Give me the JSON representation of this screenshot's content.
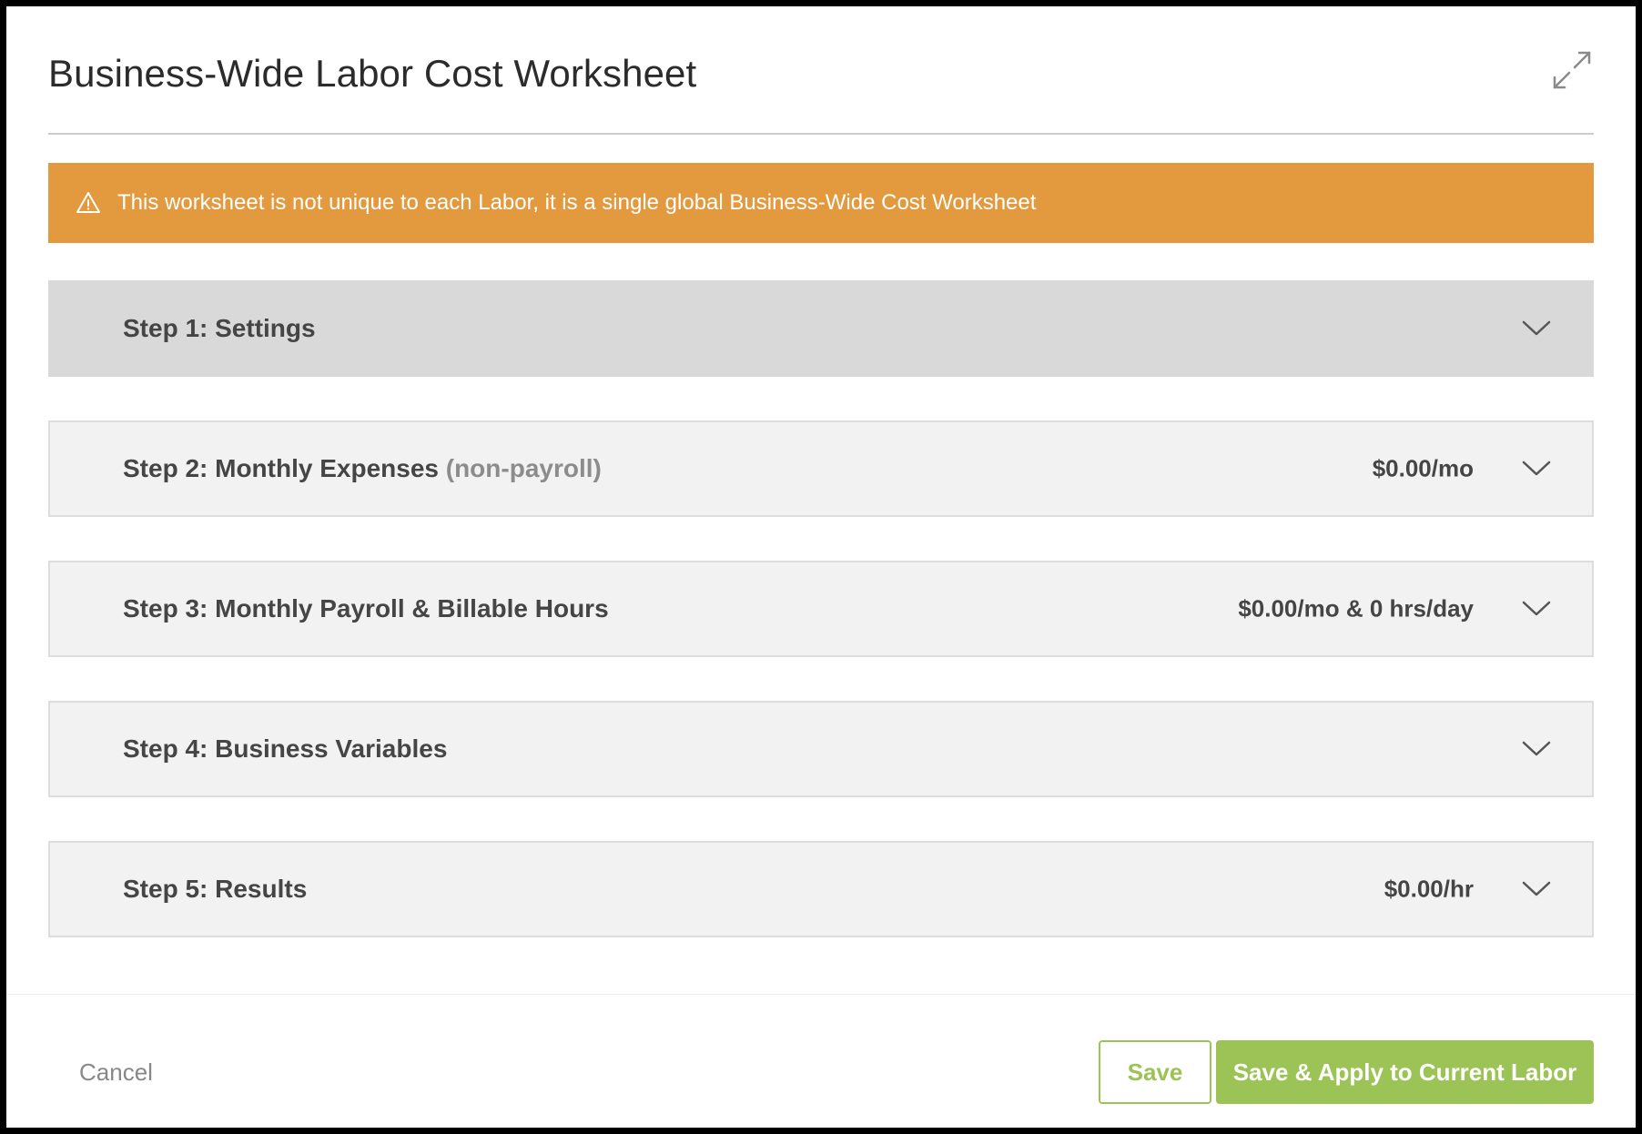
{
  "header": {
    "title": "Business-Wide Labor Cost Worksheet",
    "expand_icon": "expand-arrows-icon"
  },
  "warning": {
    "text": "This worksheet is not unique to each Labor, it is a single global Business-Wide Cost Worksheet",
    "icon": "warning-triangle-icon",
    "color": "#e3993d"
  },
  "steps": [
    {
      "title": "Step 1: Settings",
      "subtitle": "",
      "summary": "",
      "active": true
    },
    {
      "title": "Step 2: Monthly Expenses",
      "subtitle": "(non-payroll)",
      "summary": "$0.00/mo",
      "active": false
    },
    {
      "title": "Step 3: Monthly Payroll & Billable Hours",
      "subtitle": "",
      "summary": "$0.00/mo & 0 hrs/day",
      "active": false
    },
    {
      "title": "Step 4: Business Variables",
      "subtitle": "",
      "summary": "",
      "active": false
    },
    {
      "title": "Step 5: Results",
      "subtitle": "",
      "summary": "$0.00/hr",
      "active": false
    }
  ],
  "footer": {
    "cancel_label": "Cancel",
    "save_label": "Save",
    "apply_label": "Save & Apply to Current Labor",
    "accent_color": "#9cc356"
  }
}
